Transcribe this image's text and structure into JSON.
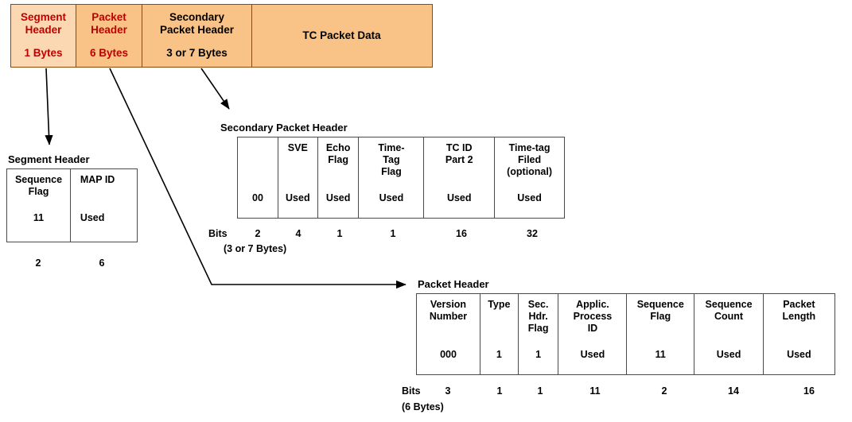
{
  "packet_structure": {
    "cells": [
      {
        "title": "Segment\nHeader",
        "size": "1 Bytes",
        "fill": "#FBD7B2",
        "text_color": "#C00000"
      },
      {
        "title": "Packet\nHeader",
        "size": "6 Bytes",
        "fill": "#F9C387",
        "text_color": "#C00000"
      },
      {
        "title": "Secondary\nPacket Header",
        "size": "3 or 7 Bytes",
        "fill": "#F9C387",
        "text_color": "#000000"
      },
      {
        "title": "TC Packet Data",
        "size": "",
        "fill": "#F9C387",
        "text_color": "#000000"
      }
    ]
  },
  "segment_header": {
    "caption": "Segment Header",
    "fields": [
      {
        "name": "Sequence\nFlag",
        "value": "11",
        "bits": "2"
      },
      {
        "name": "MAP ID",
        "value": "Used",
        "bits": "6"
      }
    ]
  },
  "secondary_packet_header": {
    "caption": "Secondary Packet Header",
    "bits_label": "Bits",
    "bytes_label": "(3 or 7 Bytes)",
    "fields": [
      {
        "name": "",
        "value": "00",
        "bits": "2"
      },
      {
        "name": "SVE",
        "value": "Used",
        "bits": "4"
      },
      {
        "name": "Echo\nFlag",
        "value": "Used",
        "bits": "1"
      },
      {
        "name": "Time-\nTag\nFlag",
        "value": "Used",
        "bits": "1"
      },
      {
        "name": "TC ID\nPart 2",
        "value": "Used",
        "bits": "16"
      },
      {
        "name": "Time-tag\nFiled\n(optional)",
        "value": "Used",
        "bits": "32"
      }
    ]
  },
  "packet_header": {
    "caption": "Packet Header",
    "bits_label": "Bits",
    "bytes_label": "(6 Bytes)",
    "fields": [
      {
        "name": "Version\nNumber",
        "value": "000",
        "bits": "3"
      },
      {
        "name": "Type",
        "value": "1",
        "bits": "1"
      },
      {
        "name": "Sec.\nHdr.\nFlag",
        "value": "1",
        "bits": "1"
      },
      {
        "name": "Applic.\nProcess\nID",
        "value": "Used",
        "bits": "11"
      },
      {
        "name": "Sequence\nFlag",
        "value": "11",
        "bits": "2"
      },
      {
        "name": "Sequence\nCount",
        "value": "Used",
        "bits": "14"
      },
      {
        "name": "Packet\nLength",
        "value": "Used",
        "bits": "16"
      }
    ]
  },
  "colors": {
    "highlight_text": "#C00000",
    "strip_border": "#8A4A10",
    "table_border": "#4A4A4A",
    "connector": "#000000"
  }
}
